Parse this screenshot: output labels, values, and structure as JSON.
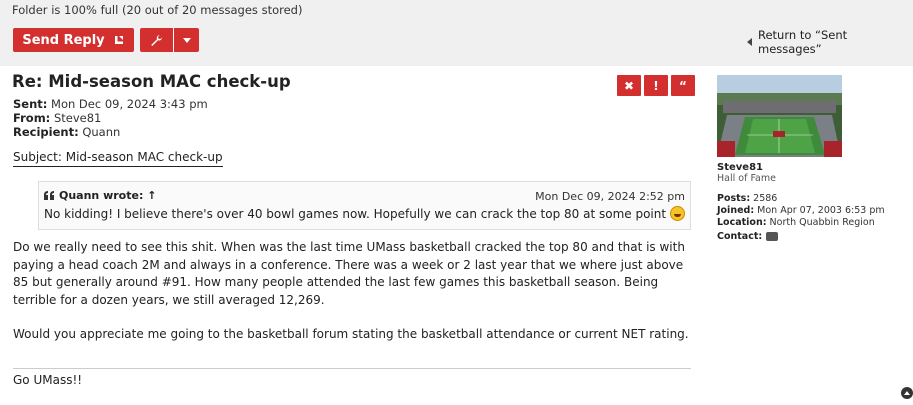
{
  "folder": {
    "status": "Folder is 100% full (20 out of 20 messages stored)"
  },
  "toolbar": {
    "reply_label": "Send Reply",
    "return_label": "Return to “Sent messages”"
  },
  "post": {
    "title": "Re: Mid-season MAC check-up",
    "sent_label": "Sent:",
    "sent_value": "Mon Dec 09, 2024 3:43 pm",
    "from_label": "From:",
    "from_value": "Steve81",
    "recipient_label": "Recipient:",
    "recipient_value": "Quann",
    "subject": "Subject: Mid-season MAC check-up",
    "quote": {
      "author": "Quann wrote: ↑",
      "date": "Mon Dec 09, 2024 2:52 pm",
      "text": "No kidding! I believe there's over 40 bowl games now. Hopefully we can crack the top 80 at some point"
    },
    "body": [
      "Do we really need to see this shit. When was the last time UMass basketball cracked the top 80 and that is with paying a head coach 2M and always in a conference. There was a week or 2 last year that we where just above 85 but generally around #91. How many people attended the last few games this basketball season. Being terrible for a dozen years, we still averaged 12,269.",
      "Would you appreciate me going to the basketball forum stating the basketball attendance or current NET rating."
    ],
    "signature": "Go UMass!!"
  },
  "actions": {
    "delete": "✖",
    "report": "!",
    "quote": "“"
  },
  "profile": {
    "username": "Steve81",
    "rank": "Hall of Fame",
    "posts_label": "Posts:",
    "posts_value": "2586",
    "joined_label": "Joined:",
    "joined_value": "Mon Apr 07, 2003 6:53 pm",
    "location_label": "Location:",
    "location_value": "North Quabbin Region",
    "contact_label": "Contact:"
  },
  "colors": {
    "accent": "#d32f2f",
    "topbar": "#f0f0f0"
  }
}
